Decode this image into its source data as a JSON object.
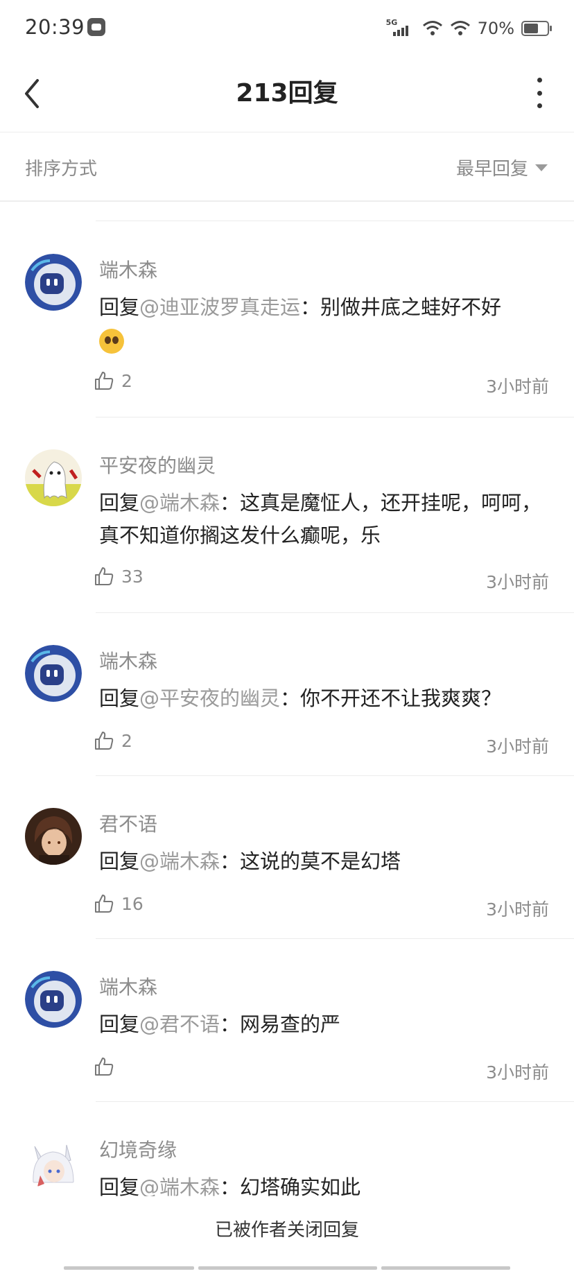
{
  "status_bar": {
    "time": "20:39",
    "network": "5G",
    "battery_percent": "70%",
    "battery_level": 0.7
  },
  "header": {
    "title": "213回复"
  },
  "sort": {
    "label": "排序方式",
    "selected": "最早回复"
  },
  "comments": [
    {
      "author": "端木森",
      "prefix": "回复",
      "mention": "@迪亚波罗真走运",
      "sep": "：",
      "text": "别做井底之蛙好不好",
      "emoji": "pleading-face-emoji",
      "likes": "2",
      "time": "3小时前",
      "avatar": "robot"
    },
    {
      "author": "平安夜的幽灵",
      "prefix": "回复",
      "mention": "@端木森",
      "sep": "：",
      "text": "这真是魔怔人，还开挂呢，呵呵，真不知道你搁这发什么癫呢，乐",
      "likes": "33",
      "time": "3小时前",
      "avatar": "ghost"
    },
    {
      "author": "端木森",
      "prefix": "回复",
      "mention": "@平安夜的幽灵",
      "sep": "：",
      "text": "你不开还不让我爽爽？",
      "likes": "2",
      "time": "3小时前",
      "avatar": "robot"
    },
    {
      "author": "君不语",
      "prefix": "回复",
      "mention": "@端木森",
      "sep": "：",
      "text": "这说的莫不是幻塔",
      "likes": "16",
      "time": "3小时前",
      "avatar": "anime-boy"
    },
    {
      "author": "端木森",
      "prefix": "回复",
      "mention": "@君不语",
      "sep": "：",
      "text": "网易查的严",
      "likes": "",
      "time": "3小时前",
      "avatar": "robot"
    },
    {
      "author": "幻境奇缘",
      "prefix": "回复",
      "mention": "@端木森",
      "sep": "：",
      "text": "幻塔确实如此",
      "avatar": "anime-fox"
    }
  ],
  "footer": {
    "text": "已被作者关闭回复"
  },
  "colors": {
    "background": "#ffffff",
    "text_primary": "#222222",
    "text_secondary": "#8c8c8c",
    "divider": "#ececec"
  }
}
